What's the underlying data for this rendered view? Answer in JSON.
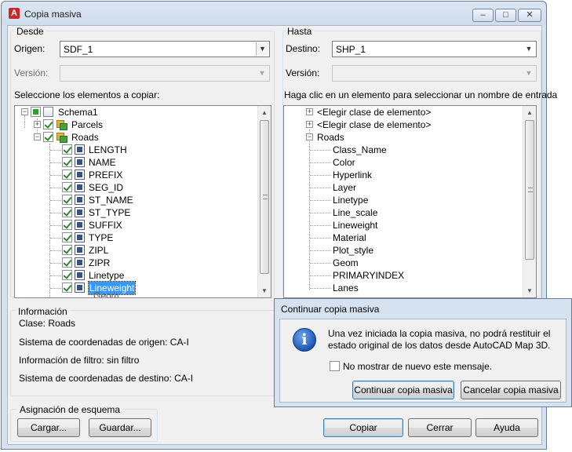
{
  "window": {
    "title": "Copia masiva",
    "app_icon": "A",
    "controls": {
      "minimize": "–",
      "maximize": "□",
      "close": "✕"
    }
  },
  "desde": {
    "group_label": "Desde",
    "origen_label": "Origen:",
    "origen_value": "SDF_1",
    "version_label": "Versión:",
    "version_value": "",
    "tree_label": "Seleccione los elementos a copiar:",
    "tree": {
      "root": "Schema1",
      "parcels": "Parcels",
      "roads": "Roads",
      "fields": [
        "LENGTH",
        "NAME",
        "PREFIX",
        "SEG_ID",
        "ST_NAME",
        "ST_TYPE",
        "SUFFIX",
        "TYPE",
        "ZIPL",
        "ZIPR",
        "Linetype",
        "Lineweight"
      ],
      "partial": "Geom"
    }
  },
  "hasta": {
    "group_label": "Hasta",
    "destino_label": "Destino:",
    "destino_value": "SHP_1",
    "version_label": "Versión:",
    "version_value": "",
    "tree_label": "Haga clic en un elemento para seleccionar un nombre de entrada",
    "tree": {
      "class1": "<Elegir clase de elemento>",
      "class2": "<Elegir clase de elemento>",
      "roads": "Roads",
      "fields": [
        "Class_Name",
        "Color",
        "Hyperlink",
        "Layer",
        "Linetype",
        "Line_scale",
        "Lineweight",
        "Material",
        "Plot_style",
        "Geom",
        "PRIMARYINDEX",
        "Lanes"
      ]
    }
  },
  "informacion": {
    "group_label": "Información",
    "clase": "Clase: Roads",
    "sistema_origen": "Sistema de coordenadas de origen: CA-I",
    "filtro": "Información de filtro: sin filtro",
    "sistema_destino": "Sistema de coordenadas de destino: CA-I"
  },
  "esquema": {
    "group_label": "Asignación de esquema",
    "cargar": "Cargar...",
    "guardar": "Guardar..."
  },
  "buttons": {
    "copiar": "Copiar",
    "cerrar": "Cerrar",
    "ayuda": "Ayuda"
  },
  "popup": {
    "title": "Continuar copia masiva",
    "message_line1": "Una vez iniciada la copia masiva, no podrá restituir el",
    "message_line2": "estado original de los datos desde AutoCAD Map 3D.",
    "checkbox_label": "No mostrar de nuevo este mensaje.",
    "continuar": "Continuar copia masiva",
    "cancelar": "Cancelar copia masiva",
    "icon_glyph": "i"
  }
}
